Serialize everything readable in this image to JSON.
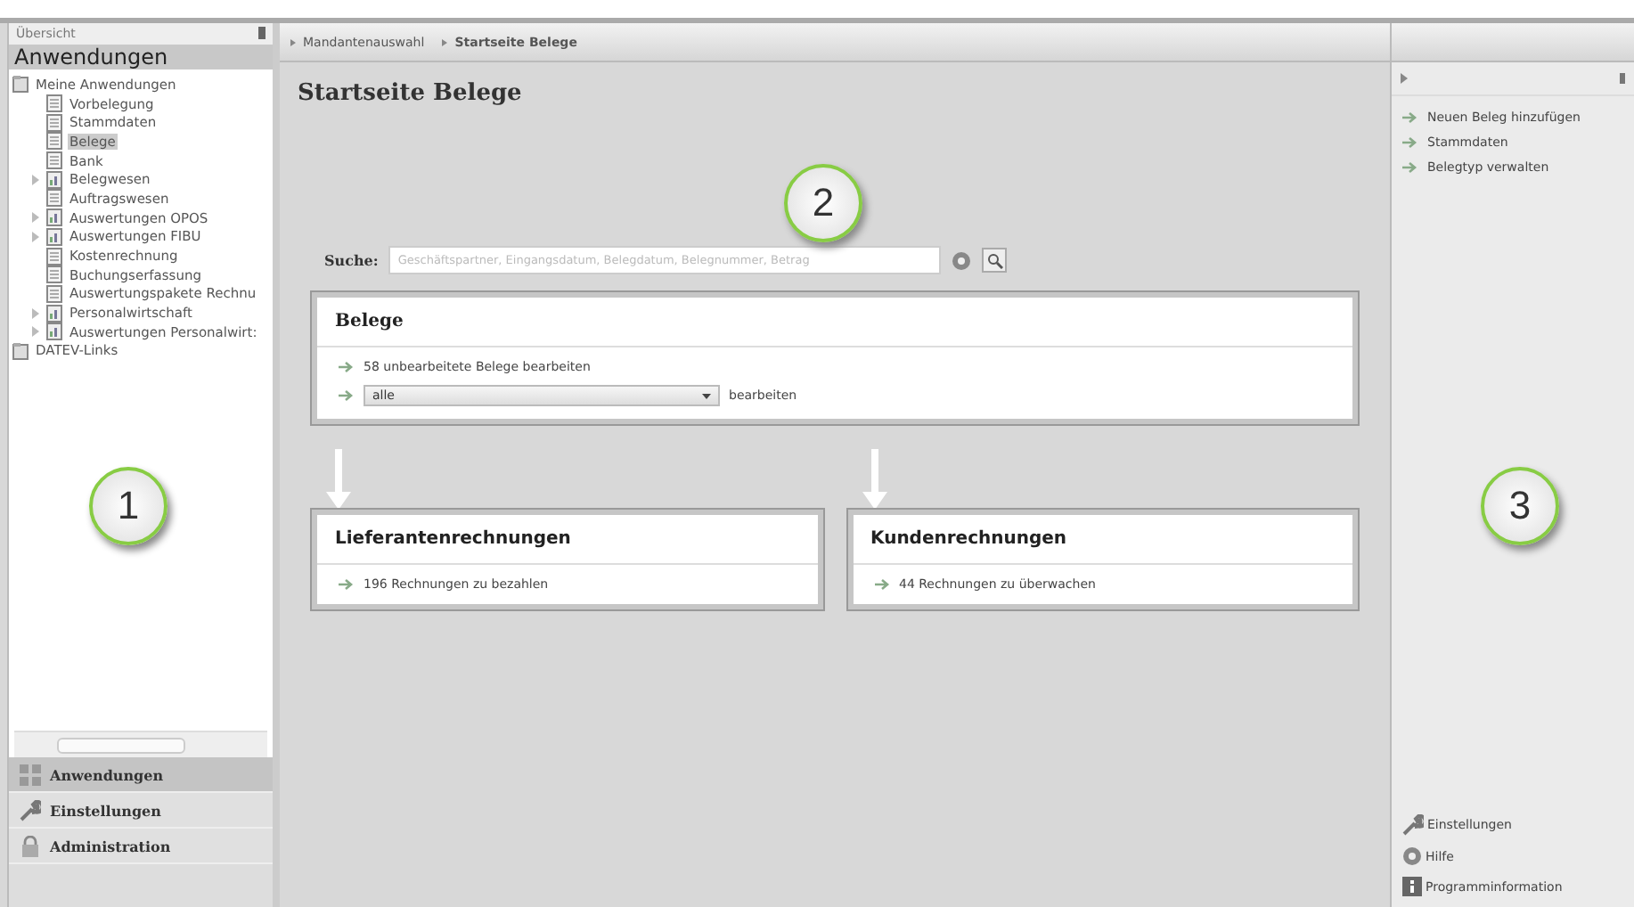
{
  "left_panel": {
    "header": "Übersicht",
    "title": "Anwendungen",
    "tree": [
      {
        "label": "Meine Anwendungen",
        "kind": "folder",
        "expanded": true,
        "selected": false,
        "children": [
          {
            "label": "Vorbelegung",
            "kind": "doc",
            "selected": false
          },
          {
            "label": "Stammdaten",
            "kind": "doc",
            "selected": false
          },
          {
            "label": "Belege",
            "kind": "doc",
            "selected": true
          },
          {
            "label": "Bank",
            "kind": "doc",
            "selected": false
          },
          {
            "label": "Belegwesen",
            "kind": "group",
            "expanded": false,
            "selected": false
          },
          {
            "label": "Auftragswesen",
            "kind": "doc",
            "selected": false
          },
          {
            "label": "Auswertungen OPOS",
            "kind": "group",
            "expanded": false,
            "selected": false
          },
          {
            "label": "Auswertungen FIBU",
            "kind": "group",
            "expanded": false,
            "selected": false
          },
          {
            "label": "Kostenrechnung",
            "kind": "doc",
            "selected": false
          },
          {
            "label": "Buchungserfassung",
            "kind": "doc",
            "selected": false
          },
          {
            "label": "Auswertungspakete Rechnu",
            "kind": "doc",
            "selected": false
          },
          {
            "label": "Personalwirtschaft",
            "kind": "group",
            "expanded": false,
            "selected": false
          },
          {
            "label": "Auswertungen Personalwirt:",
            "kind": "group",
            "expanded": false,
            "selected": false
          }
        ]
      },
      {
        "label": "DATEV-Links",
        "kind": "folder",
        "selected": false
      }
    ],
    "nav": [
      {
        "label": "Anwendungen",
        "kind": "apps",
        "selected": true
      },
      {
        "label": "Einstellungen",
        "kind": "wrench",
        "selected": false
      },
      {
        "label": "Administration",
        "kind": "lock",
        "selected": false
      }
    ]
  },
  "breadcrumb": [
    "Mandantenauswahl",
    "Startseite Belege"
  ],
  "page_title": "Startseite Belege",
  "search": {
    "label": "Suche:",
    "placeholder": "Geschäftspartner, Eingangsdatum, Belegdatum, Belegnummer, Betrag"
  },
  "belege_card": {
    "title": "Belege",
    "link": "58 unbearbeitete Belege bearbeiten",
    "dropdown_value": "alle",
    "action": "bearbeiten"
  },
  "sub_cards": [
    {
      "title": "Lieferantenrechnungen",
      "link": "196 Rechnungen zu bezahlen"
    },
    {
      "title": "Kundenrechnungen",
      "link": "44 Rechnungen zu überwachen"
    }
  ],
  "right_panel": {
    "links": [
      "Neuen Beleg hinzufügen",
      "Stammdaten",
      "Belegtyp verwalten"
    ],
    "bottom": [
      {
        "label": "Einstellungen",
        "kind": "wrench"
      },
      {
        "label": "Hilfe",
        "kind": "help"
      },
      {
        "label": "Programminformation",
        "kind": "info"
      }
    ]
  },
  "callouts": [
    "1",
    "2",
    "3"
  ]
}
